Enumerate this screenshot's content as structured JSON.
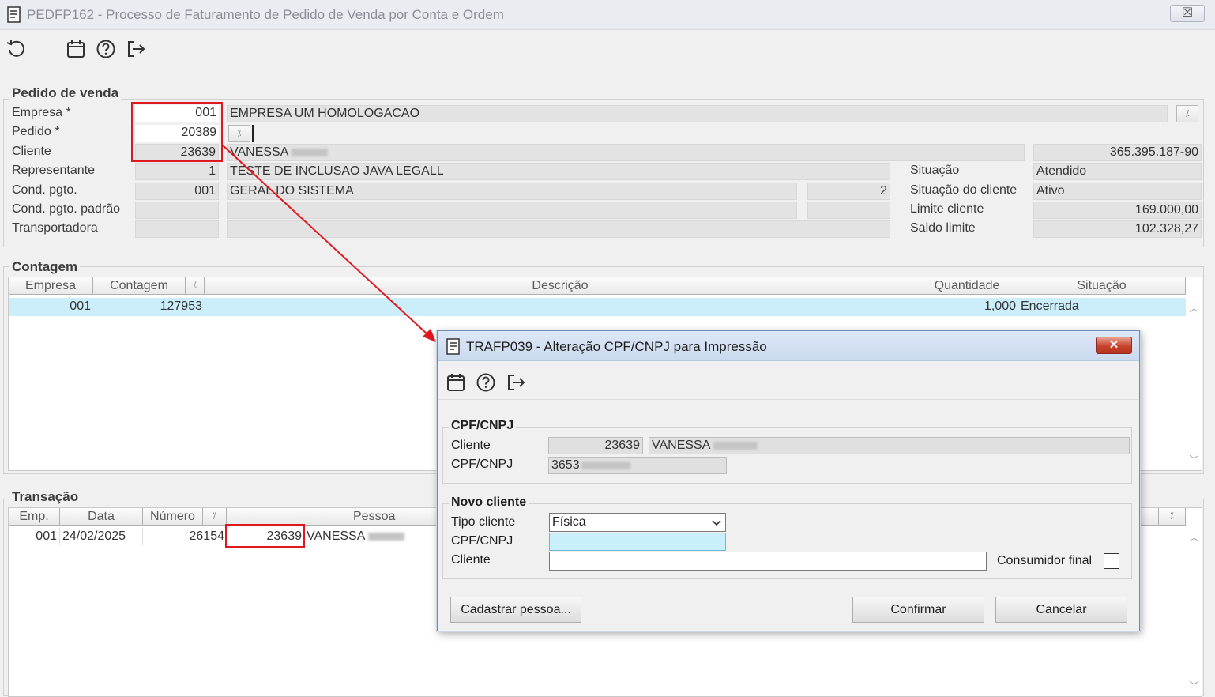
{
  "window": {
    "title": "PEDFP162 - Processo de Faturamento de Pedido de Venda por Conta e Ordem",
    "close_label": "☒"
  },
  "toolbar": {
    "icons": [
      "refresh-icon",
      "calendar-icon",
      "help-icon",
      "exit-icon"
    ]
  },
  "pedido": {
    "legend": "Pedido de venda",
    "empresa_label": "Empresa *",
    "empresa_code": "001",
    "empresa_name": "EMPRESA UM HOMOLOGACAO",
    "pedido_label": "Pedido *",
    "pedido_value": "20389",
    "cliente_label": "Cliente",
    "cliente_code": "23639",
    "cliente_name": "VANESSA",
    "cliente_doc": "365.395.187-90",
    "representante_label": "Representante",
    "representante_code": "1",
    "representante_name": "TESTE DE INCLUSAO JAVA LEGALL",
    "cond_label": "Cond. pgto.",
    "cond_code": "001",
    "cond_name": "GERAL DO SISTEMA",
    "cond_num": "2",
    "cond_padrao_label": "Cond. pgto. padrão",
    "transportadora_label": "Transportadora",
    "situacao_label": "Situação",
    "situacao_value": "Atendido",
    "situacao_cliente_label": "Situação do cliente",
    "situacao_cliente_value": "Ativo",
    "limite_label": "Limite cliente",
    "limite_value": "169.000,00",
    "saldo_label": "Saldo limite",
    "saldo_value": "102.328,27"
  },
  "contagem": {
    "legend": "Contagem",
    "columns": [
      "Empresa",
      "Contagem",
      "Descrição",
      "Quantidade",
      "Situação"
    ],
    "rows": [
      {
        "empresa": "001",
        "contagem": "127953",
        "descricao": "",
        "quantidade": "1,000",
        "situacao": "Encerrada"
      }
    ]
  },
  "transacao": {
    "legend": "Transação",
    "columns": [
      "Emp.",
      "Data",
      "Número",
      "Pessoa"
    ],
    "rows": [
      {
        "emp": "001",
        "data": "24/02/2025",
        "numero": "26154",
        "pessoa_code": "23639",
        "pessoa_name": "VANESSA"
      }
    ]
  },
  "dialog": {
    "title": "TRAFP039 - Alteração CPF/CNPJ para Impressão",
    "close_label": "✕",
    "cpf_section": {
      "legend": "CPF/CNPJ",
      "cliente_label": "Cliente",
      "cliente_code": "23639",
      "cliente_name": "VANESSA",
      "cpf_label": "CPF/CNPJ",
      "cpf_value": "3653"
    },
    "novo_section": {
      "legend": "Novo cliente",
      "tipo_label": "Tipo cliente",
      "tipo_value": "Física",
      "cpf_label": "CPF/CNPJ",
      "cpf_value": "",
      "cliente_label": "Cliente",
      "cliente_value": "",
      "consumidor_label": "Consumidor final",
      "consumidor_checked": false
    },
    "buttons": {
      "cadastrar": "Cadastrar pessoa...",
      "confirmar": "Confirmar",
      "cancelar": "Cancelar"
    }
  },
  "colors": {
    "highlight_red": "#e0171c",
    "selected_row": "#cbeefa",
    "dialog_close": "#c8432d"
  }
}
